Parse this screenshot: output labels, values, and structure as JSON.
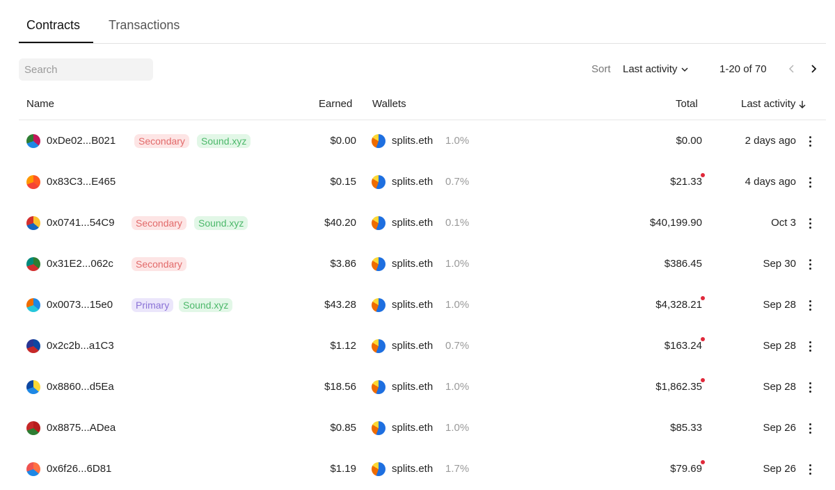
{
  "tabs": [
    {
      "label": "Contracts",
      "active": true
    },
    {
      "label": "Transactions",
      "active": false
    }
  ],
  "search": {
    "placeholder": "Search"
  },
  "sort": {
    "label": "Sort",
    "value": "Last activity",
    "icon": "chevron-down-icon"
  },
  "pagination": {
    "text": "1-20 of 70",
    "prev_icon": "chevron-left-icon",
    "next_icon": "chevron-right-icon"
  },
  "columns": {
    "name": "Name",
    "earned": "Earned",
    "wallets": "Wallets",
    "total": "Total",
    "last_activity": "Last activity",
    "sort_icon": "arrow-down-icon"
  },
  "colors": {
    "secondary_bg": "#fde5e5",
    "secondary_fg": "#e26a6a",
    "sound_bg": "#e2f7e7",
    "sound_fg": "#4cb86a",
    "primary_bg": "#ebe6fb",
    "primary_fg": "#8a72d6",
    "alert_dot": "#e0283a"
  },
  "rows": [
    {
      "address": "0xDe02...B021",
      "tags": [
        "Secondary",
        "Sound.xyz"
      ],
      "earned": "$0.00",
      "wallet": "splits.eth",
      "pct": "1.0%",
      "total": "$0.00",
      "alert": false,
      "activity": "2 days ago"
    },
    {
      "address": "0x83C3...E465",
      "tags": [],
      "earned": "$0.15",
      "wallet": "splits.eth",
      "pct": "0.7%",
      "total": "$21.33",
      "alert": true,
      "activity": "4 days ago"
    },
    {
      "address": "0x0741...54C9",
      "tags": [
        "Secondary",
        "Sound.xyz"
      ],
      "earned": "$40.20",
      "wallet": "splits.eth",
      "pct": "0.1%",
      "total": "$40,199.90",
      "alert": false,
      "activity": "Oct 3"
    },
    {
      "address": "0x31E2...062c",
      "tags": [
        "Secondary"
      ],
      "earned": "$3.86",
      "wallet": "splits.eth",
      "pct": "1.0%",
      "total": "$386.45",
      "alert": false,
      "activity": "Sep 30"
    },
    {
      "address": "0x0073...15e0",
      "tags": [
        "Primary",
        "Sound.xyz"
      ],
      "earned": "$43.28",
      "wallet": "splits.eth",
      "pct": "1.0%",
      "total": "$4,328.21",
      "alert": true,
      "activity": "Sep 28"
    },
    {
      "address": "0x2c2b...a1C3",
      "tags": [],
      "earned": "$1.12",
      "wallet": "splits.eth",
      "pct": "0.7%",
      "total": "$163.24",
      "alert": true,
      "activity": "Sep 28"
    },
    {
      "address": "0x8860...d5Ea",
      "tags": [],
      "earned": "$18.56",
      "wallet": "splits.eth",
      "pct": "1.0%",
      "total": "$1,862.35",
      "alert": true,
      "activity": "Sep 28"
    },
    {
      "address": "0x8875...ADea",
      "tags": [],
      "earned": "$0.85",
      "wallet": "splits.eth",
      "pct": "1.0%",
      "total": "$85.33",
      "alert": false,
      "activity": "Sep 26"
    },
    {
      "address": "0x6f26...6D81",
      "tags": [],
      "earned": "$1.19",
      "wallet": "splits.eth",
      "pct": "1.7%",
      "total": "$79.69",
      "alert": true,
      "activity": "Sep 26"
    }
  ]
}
